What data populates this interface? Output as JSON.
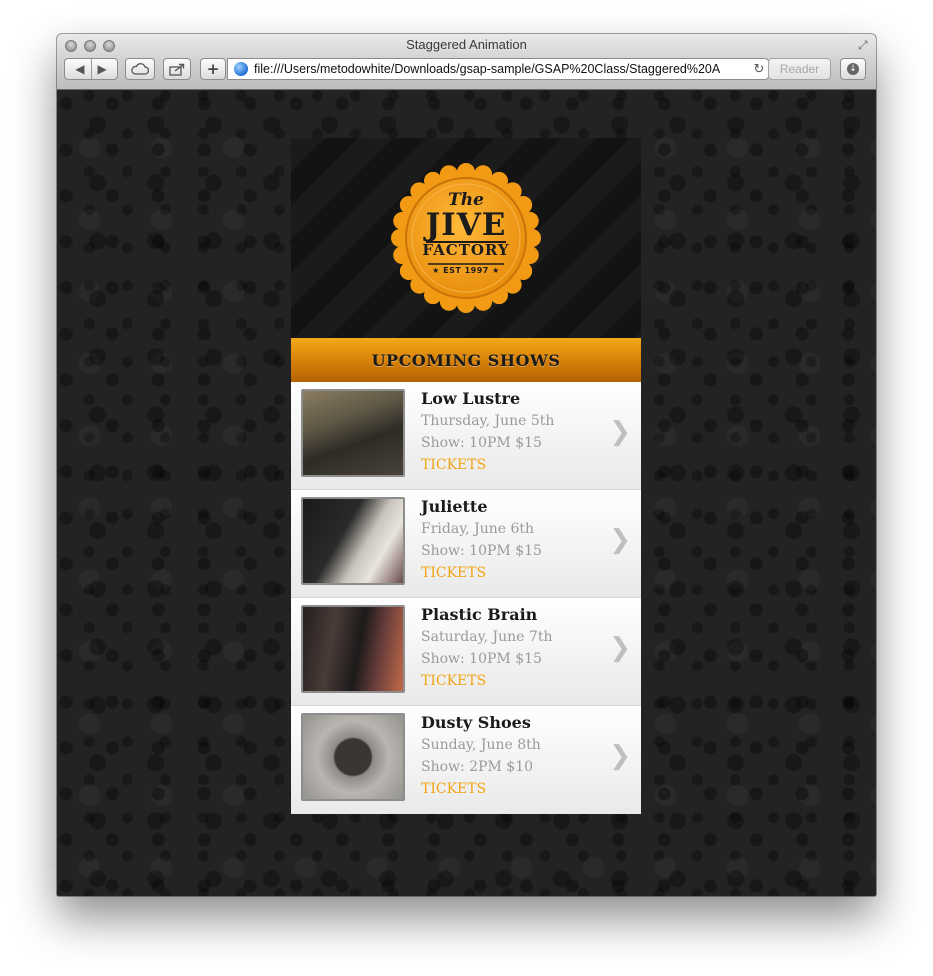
{
  "browser": {
    "title": "Staggered Animation",
    "url": "file:///Users/metodowhite/Downloads/gsap-sample/GSAP%20Class/Staggered%20A",
    "reader_label": "Reader",
    "add_label": "+",
    "reload_icon": "reload-icon"
  },
  "logo": {
    "the": "The",
    "jive": "JIVE",
    "factory": "FACTORY",
    "est": "★ EST 1997 ★",
    "accent": "#f5a51c"
  },
  "section": {
    "title": "UPCOMING SHOWS"
  },
  "shows": [
    {
      "name": "Low Lustre",
      "date": "Thursday, June 5th",
      "time": "Show: 10PM $15",
      "tickets": "TICKETS"
    },
    {
      "name": "Juliette",
      "date": "Friday, June 6th",
      "time": "Show: 10PM $15",
      "tickets": "TICKETS"
    },
    {
      "name": "Plastic Brain",
      "date": "Saturday, June 7th",
      "time": "Show: 10PM $15",
      "tickets": "TICKETS"
    },
    {
      "name": "Dusty Shoes",
      "date": "Sunday, June 8th",
      "time": "Show: 2PM $10",
      "tickets": "TICKETS"
    }
  ],
  "colors": {
    "header_orange": "#e7950f",
    "ticket_orange": "#f2a414",
    "page_bg": "#232323"
  }
}
